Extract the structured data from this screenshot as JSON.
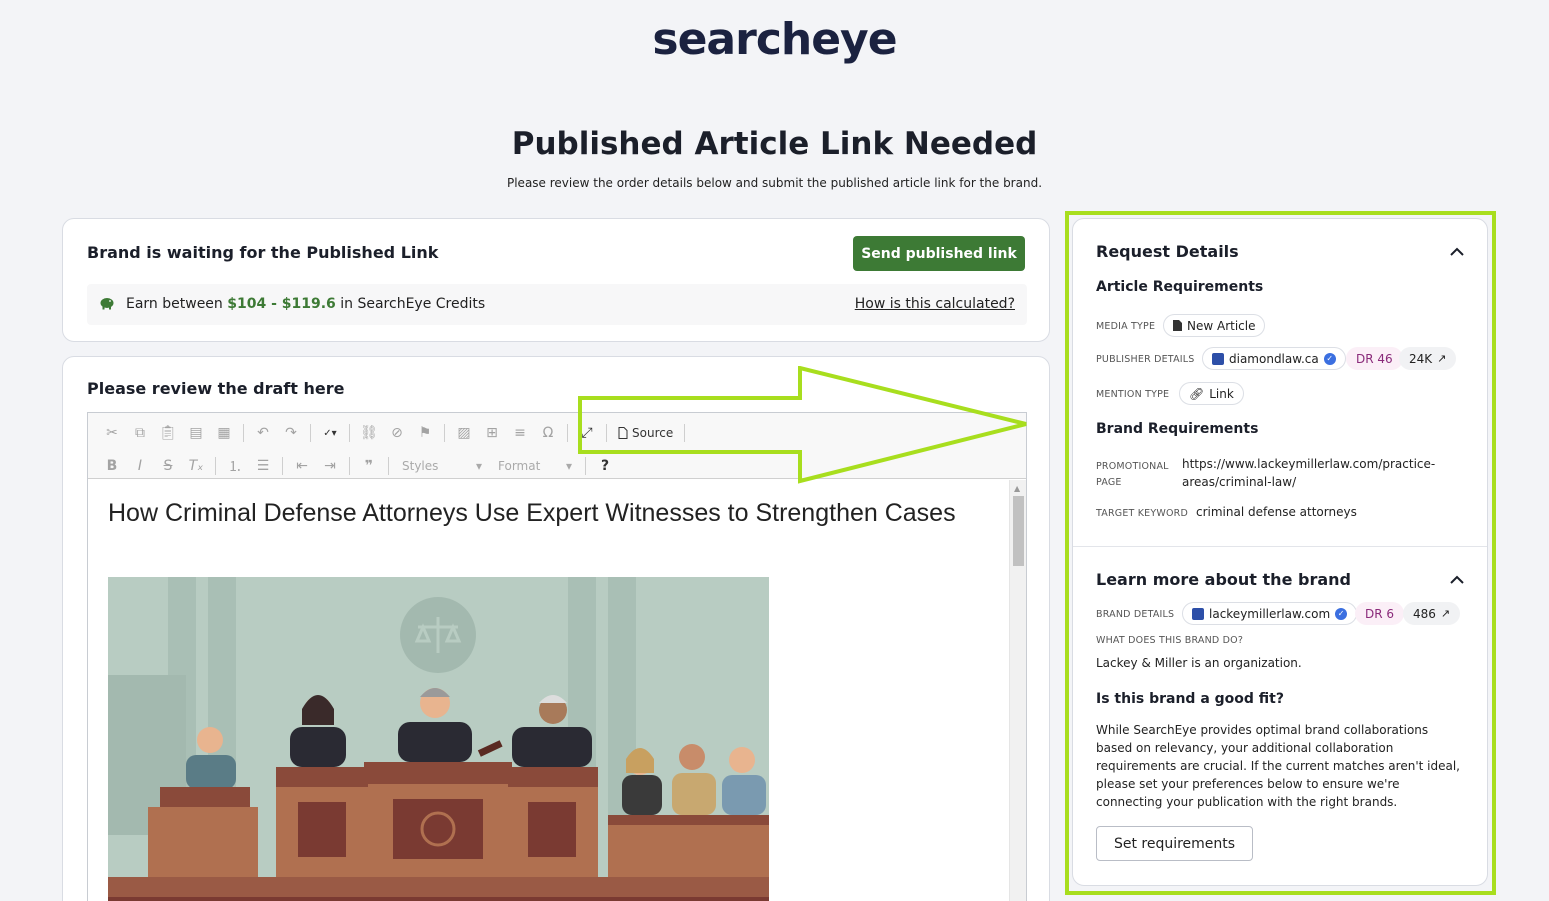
{
  "brand": {
    "logo_text": "searcheye"
  },
  "header": {
    "title": "Published Article Link Needed",
    "subtitle": "Please review the order details below and submit the published article link for the brand."
  },
  "status_card": {
    "heading": "Brand is waiting for the Published Link",
    "send_button": "Send published link",
    "earn_prefix": "Earn between",
    "earn_range": "$104 - $119.6",
    "earn_suffix": "in SearchEye Credits",
    "calc_link": "How is this calculated?"
  },
  "draft_card": {
    "heading": "Please review the draft here",
    "toolbar": {
      "source_label": "Source",
      "styles_label": "Styles",
      "format_label": "Format",
      "help_label": "?"
    },
    "article_title": "How Criminal Defense Attorneys Use Expert Witnesses to Strengthen Cases"
  },
  "request_details": {
    "title": "Request Details",
    "article_requirements": "Article Requirements",
    "media_type_label": "MEDIA TYPE",
    "media_type_value": "New Article",
    "publisher_label": "PUBLISHER DETAILS",
    "publisher_domain": "diamondlaw.ca",
    "publisher_dr": "DR 46",
    "publisher_traffic": "24K",
    "mention_label": "MENTION TYPE",
    "mention_value": "Link",
    "brand_requirements": "Brand Requirements",
    "promo_label_1": "PROMOTIONAL",
    "promo_label_2": "PAGE",
    "promo_value_1": "https://www.lackeymillerlaw.com/practice-",
    "promo_value_2": "areas/criminal-law/",
    "keyword_label": "TARGET KEYWORD",
    "keyword_value": "criminal defense attorneys"
  },
  "brand_info": {
    "title": "Learn more about the brand",
    "details_label": "BRAND DETAILS",
    "domain": "lackeymillerlaw.com",
    "dr": "DR 6",
    "traffic": "486",
    "what_label": "WHAT DOES THIS BRAND DO?",
    "what_value": "Lackey & Miller is an organization.",
    "fit_title": "Is this brand a good fit?",
    "fit_text": "While SearchEye provides optimal brand collaborations based on relevancy, your additional collaboration requirements are crucial. If the current matches aren't ideal, please set your preferences below to ensure we're connecting your publication with the right brands.",
    "set_button": "Set requirements"
  },
  "colors": {
    "accent_green": "#3d7a35",
    "highlight": "#a8de1e",
    "navy": "#1b2240"
  }
}
